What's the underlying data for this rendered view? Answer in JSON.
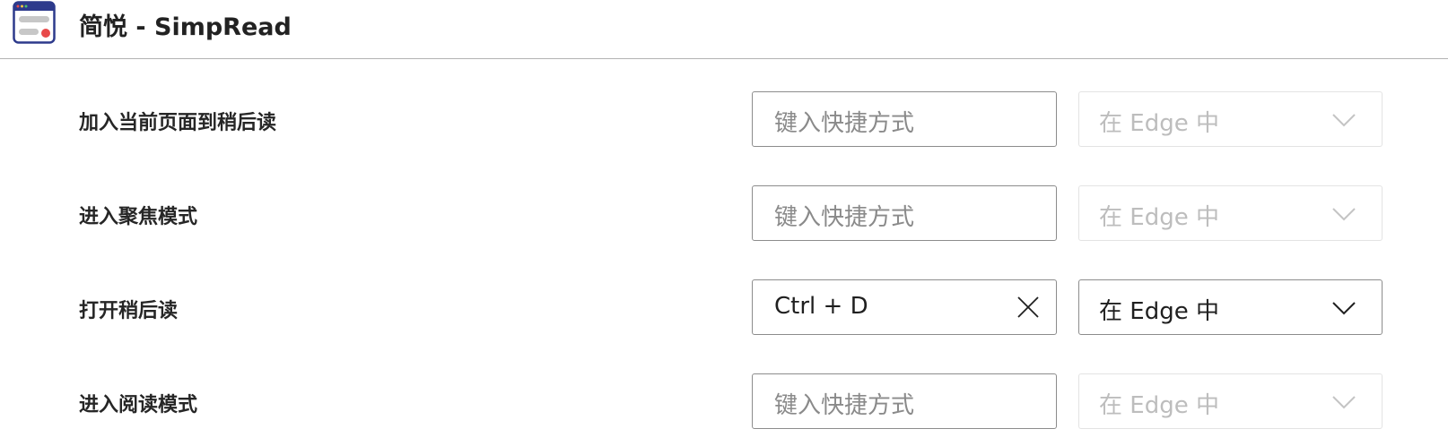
{
  "header": {
    "title": "简悦 - SimpRead",
    "icon": "simpread-app-icon"
  },
  "shortcuts": [
    {
      "label": "加入当前页面到稍后读",
      "shortcut_value": "",
      "shortcut_placeholder": "键入快捷方式",
      "scope": "在 Edge 中",
      "scope_enabled": false
    },
    {
      "label": "进入聚焦模式",
      "shortcut_value": "",
      "shortcut_placeholder": "键入快捷方式",
      "scope": "在 Edge 中",
      "scope_enabled": false
    },
    {
      "label": "打开稍后读",
      "shortcut_value": "Ctrl + D",
      "shortcut_placeholder": "键入快捷方式",
      "scope": "在 Edge 中",
      "scope_enabled": true
    },
    {
      "label": "进入阅读模式",
      "shortcut_value": "",
      "shortcut_placeholder": "键入快捷方式",
      "scope": "在 Edge 中",
      "scope_enabled": false
    }
  ],
  "colors": {
    "icon_frame": "#2d3a8c",
    "icon_dot": "#e84a4a"
  }
}
